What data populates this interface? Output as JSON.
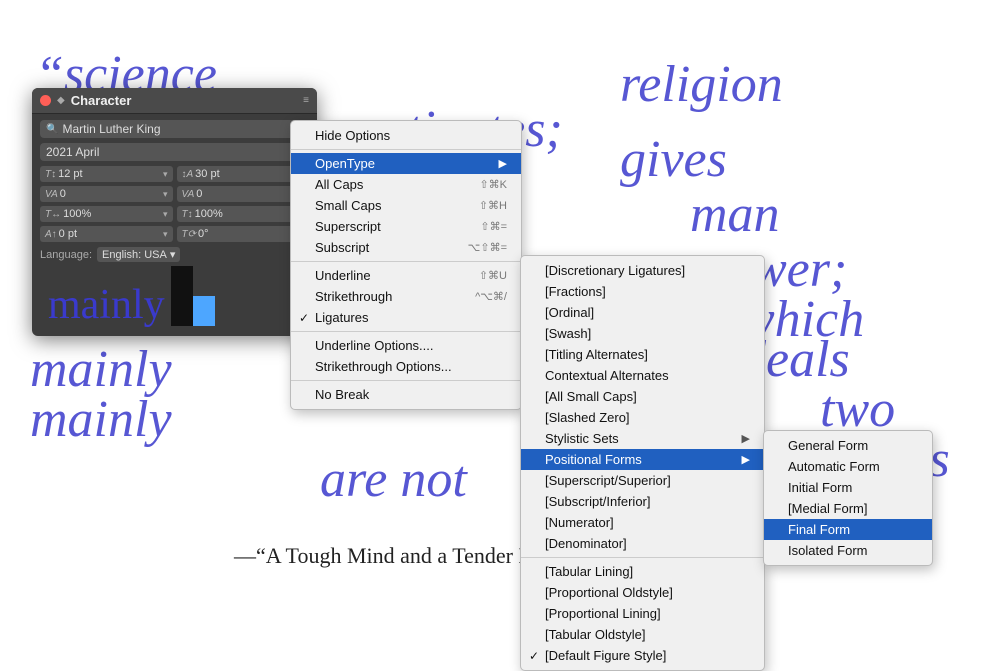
{
  "background": {
    "handwriting": [
      {
        "text": "“science",
        "class": "hw1"
      },
      {
        "text": "investigates;",
        "class": "hw2"
      },
      {
        "text": "religion",
        "class": "hw3"
      },
      {
        "text": "gives",
        "class": "hw4"
      },
      {
        "text": "man",
        "class": "hw5"
      },
      {
        "text": "power;",
        "class": "hw6"
      },
      {
        "text": "which",
        "class": "hw7"
      },
      {
        "text": "deals",
        "class": "hw8"
      },
      {
        "text": "mainly",
        "class": "hw9"
      },
      {
        "text": "mainly",
        "class": "hw10"
      },
      {
        "text": "two",
        "class": "hw11"
      },
      {
        "text": "deals",
        "class": "hw12"
      },
      {
        "text": "are not",
        "class": "hw13"
      }
    ],
    "bottom_quote": "—“A Tough Mind and a Tender Heart,”   on, August 30, 1959"
  },
  "character_panel": {
    "title": "Character",
    "font_name": "Martin Luther King",
    "font_style": "2021 April",
    "font_size": "12 pt",
    "leading": "30 pt",
    "kerning": "0",
    "tracking": "0",
    "horizontal_scale": "100%",
    "vertical_scale": "100%",
    "baseline_shift": "0 pt",
    "rotation": "0°",
    "language": "English: USA"
  },
  "menu_l1": {
    "items": [
      {
        "id": "hide-options",
        "label": "Hide Options",
        "shortcut": "",
        "check": "",
        "arrow": false,
        "hovered": false,
        "separator_after": true
      },
      {
        "id": "opentype",
        "label": "OpenType",
        "shortcut": "",
        "check": "",
        "arrow": true,
        "hovered": true,
        "separator_after": false
      },
      {
        "id": "all-caps",
        "label": "All Caps",
        "shortcut": "⇧⌘K",
        "check": "",
        "arrow": false,
        "hovered": false,
        "separator_after": false
      },
      {
        "id": "small-caps",
        "label": "Small Caps",
        "shortcut": "⇧⌘H",
        "check": "",
        "arrow": false,
        "hovered": false,
        "separator_after": false
      },
      {
        "id": "superscript",
        "label": "Superscript",
        "shortcut": "⇧⌘=",
        "check": "",
        "arrow": false,
        "hovered": false,
        "separator_after": false
      },
      {
        "id": "subscript",
        "label": "Subscript",
        "shortcut": "⌥⇧⌘=",
        "check": "",
        "arrow": false,
        "hovered": false,
        "separator_after": true
      },
      {
        "id": "underline",
        "label": "Underline",
        "shortcut": "⇧⌘U",
        "check": "",
        "arrow": false,
        "hovered": false,
        "separator_after": false
      },
      {
        "id": "strikethrough",
        "label": "Strikethrough",
        "shortcut": "^⌥⌘/",
        "check": "",
        "arrow": false,
        "hovered": false,
        "separator_after": false
      },
      {
        "id": "ligatures",
        "label": "Ligatures",
        "shortcut": "",
        "check": "✓",
        "arrow": false,
        "hovered": false,
        "separator_after": true
      },
      {
        "id": "underline-options",
        "label": "Underline Options....",
        "shortcut": "",
        "check": "",
        "arrow": false,
        "hovered": false,
        "separator_after": false
      },
      {
        "id": "strikethrough-options",
        "label": "Strikethrough Options...",
        "shortcut": "",
        "check": "",
        "arrow": false,
        "hovered": false,
        "separator_after": true
      },
      {
        "id": "no-break",
        "label": "No Break",
        "shortcut": "",
        "check": "",
        "arrow": false,
        "hovered": false,
        "separator_after": false
      }
    ]
  },
  "menu_l2": {
    "items": [
      {
        "id": "disc-lig",
        "label": "[Discretionary Ligatures]",
        "shortcut": "",
        "check": "",
        "arrow": false,
        "hovered": false
      },
      {
        "id": "fractions",
        "label": "[Fractions]",
        "shortcut": "",
        "check": "",
        "arrow": false,
        "hovered": false
      },
      {
        "id": "ordinal",
        "label": "[Ordinal]",
        "shortcut": "",
        "check": "",
        "arrow": false,
        "hovered": false
      },
      {
        "id": "swash",
        "label": "[Swash]",
        "shortcut": "",
        "check": "",
        "arrow": false,
        "hovered": false
      },
      {
        "id": "titling-alt",
        "label": "[Titling Alternates]",
        "shortcut": "",
        "check": "",
        "arrow": false,
        "hovered": false
      },
      {
        "id": "contextual-alt",
        "label": "Contextual Alternates",
        "shortcut": "",
        "check": "",
        "arrow": false,
        "hovered": false
      },
      {
        "id": "all-small-caps",
        "label": "[All Small Caps]",
        "shortcut": "",
        "check": "",
        "arrow": false,
        "hovered": false
      },
      {
        "id": "slashed-zero",
        "label": "[Slashed Zero]",
        "shortcut": "",
        "check": "",
        "arrow": false,
        "hovered": false
      },
      {
        "id": "stylistic-sets",
        "label": "Stylistic Sets",
        "shortcut": "",
        "check": "",
        "arrow": true,
        "hovered": false
      },
      {
        "id": "positional-forms",
        "label": "Positional Forms",
        "shortcut": "",
        "check": "",
        "arrow": true,
        "hovered": true
      },
      {
        "id": "superscript-sup",
        "label": "[Superscript/Superior]",
        "shortcut": "",
        "check": "",
        "arrow": false,
        "hovered": false
      },
      {
        "id": "subscript-inf",
        "label": "[Subscript/Inferior]",
        "shortcut": "",
        "check": "",
        "arrow": false,
        "hovered": false
      },
      {
        "id": "numerator",
        "label": "[Numerator]",
        "shortcut": "",
        "check": "",
        "arrow": false,
        "hovered": false
      },
      {
        "id": "denominator",
        "label": "[Denominator]",
        "shortcut": "",
        "check": "",
        "arrow": false,
        "hovered": false
      },
      {
        "id": "sep1",
        "label": "",
        "separator": true
      },
      {
        "id": "tabular-lining",
        "label": "[Tabular Lining]",
        "shortcut": "",
        "check": "",
        "arrow": false,
        "hovered": false
      },
      {
        "id": "prop-oldstyle",
        "label": "[Proportional Oldstyle]",
        "shortcut": "",
        "check": "",
        "arrow": false,
        "hovered": false
      },
      {
        "id": "prop-lining",
        "label": "[Proportional Lining]",
        "shortcut": "",
        "check": "",
        "arrow": false,
        "hovered": false
      },
      {
        "id": "tabular-oldstyle",
        "label": "[Tabular Oldstyle]",
        "shortcut": "",
        "check": "",
        "arrow": false,
        "hovered": false
      },
      {
        "id": "default-figure",
        "label": "[Default Figure Style]",
        "shortcut": "",
        "check": "✓",
        "arrow": false,
        "hovered": false
      }
    ]
  },
  "menu_l3": {
    "items": [
      {
        "id": "general-form",
        "label": "General Form",
        "check": "",
        "hovered": false
      },
      {
        "id": "automatic-form",
        "label": "Automatic Form",
        "check": "",
        "hovered": false
      },
      {
        "id": "initial-form",
        "label": "Initial Form",
        "check": "",
        "hovered": false
      },
      {
        "id": "medial-form",
        "label": "[Medial Form]",
        "check": "",
        "hovered": false
      },
      {
        "id": "final-form",
        "label": "Final Form",
        "check": "",
        "hovered": true
      },
      {
        "id": "isolated-form",
        "label": "Isolated Form",
        "check": "",
        "hovered": false
      }
    ]
  }
}
